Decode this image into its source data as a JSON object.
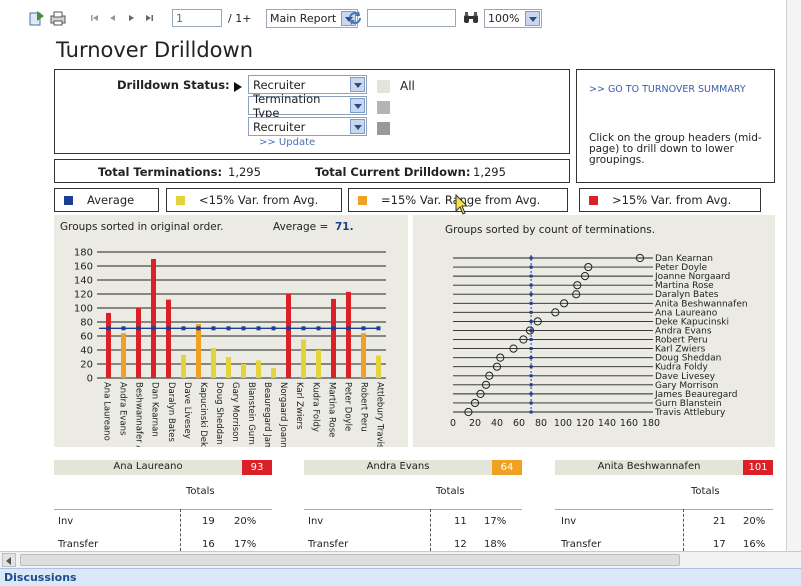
{
  "toolbar": {
    "page_value": "1",
    "page_total": "/ 1+",
    "report_select": "Main Report",
    "search_value": "",
    "zoom": "100%"
  },
  "title": "Turnover Drilldown",
  "drilldown": {
    "label": "Drilldown Status:",
    "selects": [
      "Recruiter",
      "Termination Type",
      "Recruiter"
    ],
    "all_label": "All",
    "update_label": ">> Update",
    "swatch_colors": [
      "#e4e4dc",
      "#b5b5b0",
      "#9a9a94"
    ]
  },
  "summary": {
    "link": ">> GO TO TURNOVER SUMMARY",
    "hint": "Click on the group headers (mid-page) to drill down to lower groupings."
  },
  "totals": {
    "terminations_label": "Total Terminations:",
    "terminations_value": "1,295",
    "drilldown_label": "Total Current Drilldown:",
    "drilldown_value": "1,295"
  },
  "legend": [
    {
      "label": "Average",
      "color": "#1c3f94"
    },
    {
      "label": "<15% Var. from Avg.",
      "color": "#e2d43a"
    },
    {
      "label": "=15% Var. Range from Avg.",
      "color": "#f0a023"
    },
    {
      "label": ">15% Var. from Avg.",
      "color": "#dc2028"
    }
  ],
  "left_panel": {
    "caption": "Groups sorted in original order.",
    "average_label": "Average =",
    "average_value": "71."
  },
  "right_panel": {
    "caption": "Groups sorted by count of terminations."
  },
  "chart_data": [
    {
      "type": "bar",
      "y_ticks": [
        0,
        20,
        40,
        60,
        80,
        100,
        120,
        140,
        160,
        180
      ],
      "ylim": [
        0,
        180
      ],
      "average": 71,
      "categories": [
        "Ana Laureano",
        "Andra Evans",
        "Anita Beshwannafen",
        "Dan Kearnan",
        "Daralyn Bates",
        "Dave Livesey",
        "Deke Kapucinski",
        "Doug Sheddan",
        "Gary Morrison",
        "Gurn Blanstein",
        "James Beauregard",
        "Joanne Norgaard",
        "Karl Zwiers",
        "Kudra Foldy",
        "Martina Rose",
        "Peter Doyle",
        "Robert Peru",
        "Travis Attlebury"
      ],
      "labels": [
        "Ana Laureano",
        "Andra Evans",
        "Beshwannafer Anita",
        "Dan Kearnan",
        "Daralyn Bates",
        "Dave Livesey",
        "Kapucinski Deke",
        "Doug Sheddan",
        "Gary Morrison",
        "Blanstein Gurn",
        "Beauregard James",
        "Norgaard Joanne",
        "Karl Zwiers",
        "Kudra Foldy",
        "Martina Rose",
        "Peter Doyle",
        "Robert Peru",
        "Attlebury Travis"
      ],
      "values": [
        93,
        64,
        101,
        170,
        112,
        33,
        77,
        43,
        30,
        20,
        25,
        14,
        120,
        55,
        40,
        113,
        123,
        64,
        32
      ],
      "colors": [
        "#dc2028",
        "#f0a023",
        "#dc2028",
        "#dc2028",
        "#dc2028",
        "#e2d43a",
        "#f0a023",
        "#e2d43a",
        "#e2d43a",
        "#e2d43a",
        "#e2d43a",
        "#e2d43a",
        "#dc2028",
        "#e2d43a",
        "#e2d43a",
        "#dc2028",
        "#dc2028",
        "#f0a023",
        "#e2d43a"
      ]
    },
    {
      "type": "scatter",
      "x_ticks": [
        0,
        20,
        40,
        60,
        80,
        100,
        120,
        140,
        160,
        180
      ],
      "xlim": [
        0,
        180
      ],
      "average": 71,
      "categories": [
        "Dan Kearnan",
        "Peter Doyle",
        "Joanne Norgaard",
        "Martina Rose",
        "Daralyn Bates",
        "Anita Beshwannafen",
        "Ana Laureano",
        "Deke Kapucinski",
        "Andra Evans",
        "Robert Peru",
        "Karl Zwiers",
        "Doug Sheddan",
        "Kudra Foldy",
        "Dave Livesey",
        "Gary Morrison",
        "James Beauregard",
        "Gurn Blanstein",
        "Travis Attlebury"
      ],
      "values": [
        170,
        123,
        120,
        113,
        112,
        101,
        93,
        77,
        70,
        64,
        55,
        43,
        40,
        33,
        30,
        25,
        20,
        14
      ]
    }
  ],
  "groups": [
    {
      "name": "Ana Laureano",
      "value": "93",
      "color": "#dc2028",
      "totals_label": "Totals",
      "rows": [
        {
          "type": "Inv",
          "count": "19",
          "pct": "20%"
        },
        {
          "type": "Transfer",
          "count": "16",
          "pct": "17%"
        }
      ]
    },
    {
      "name": "Andra Evans",
      "value": "64",
      "color": "#f0a023",
      "totals_label": "Totals",
      "rows": [
        {
          "type": "Inv",
          "count": "11",
          "pct": "17%"
        },
        {
          "type": "Transfer",
          "count": "12",
          "pct": "18%"
        }
      ]
    },
    {
      "name": "Anita Beshwannafen",
      "value": "101",
      "color": "#dc2028",
      "totals_label": "Totals",
      "rows": [
        {
          "type": "Inv",
          "count": "21",
          "pct": "20%"
        },
        {
          "type": "Transfer",
          "count": "17",
          "pct": "16%"
        }
      ]
    }
  ],
  "footer": {
    "discussions": "Discussions"
  }
}
